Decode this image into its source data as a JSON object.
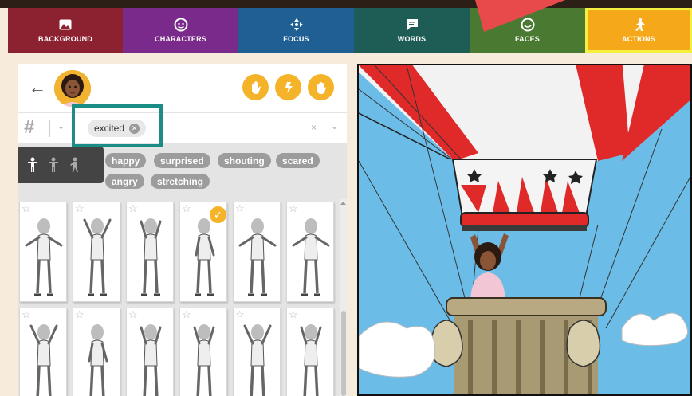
{
  "tabs": [
    {
      "label": "BACKGROUND",
      "icon": "image-icon",
      "color": "#8c2230"
    },
    {
      "label": "CHARACTERS",
      "icon": "face-icon",
      "color": "#7a2a8a"
    },
    {
      "label": "FOCUS",
      "icon": "move-arrows-icon",
      "color": "#1f5f94"
    },
    {
      "label": "WORDS",
      "icon": "speech-bubble-icon",
      "color": "#1e5d55"
    },
    {
      "label": "FACES",
      "icon": "smiley-icon",
      "color": "#4a7a32"
    },
    {
      "label": "ACTIONS",
      "icon": "running-person-icon",
      "color": "#f6a81b",
      "active": true
    }
  ],
  "header": {
    "back_icon": "back-arrow-icon",
    "buttons": [
      "hand-icon",
      "bolt-icon",
      "wave-hand-icon"
    ]
  },
  "search": {
    "hash": "#",
    "chip": "excited",
    "clear": "×"
  },
  "pose_filters": [
    "standing-figure-icon",
    "standing-figure-icon",
    "walking-figure-icon"
  ],
  "tags": [
    "happy",
    "surprised",
    "shouting",
    "scared",
    "angry",
    "stretching"
  ],
  "grid": {
    "selected_index": 3,
    "rows": 2,
    "cols": 6
  },
  "colors": {
    "accent": "#f4b329",
    "highlight": "#1a8e84",
    "active_outline": "#f4f040"
  }
}
